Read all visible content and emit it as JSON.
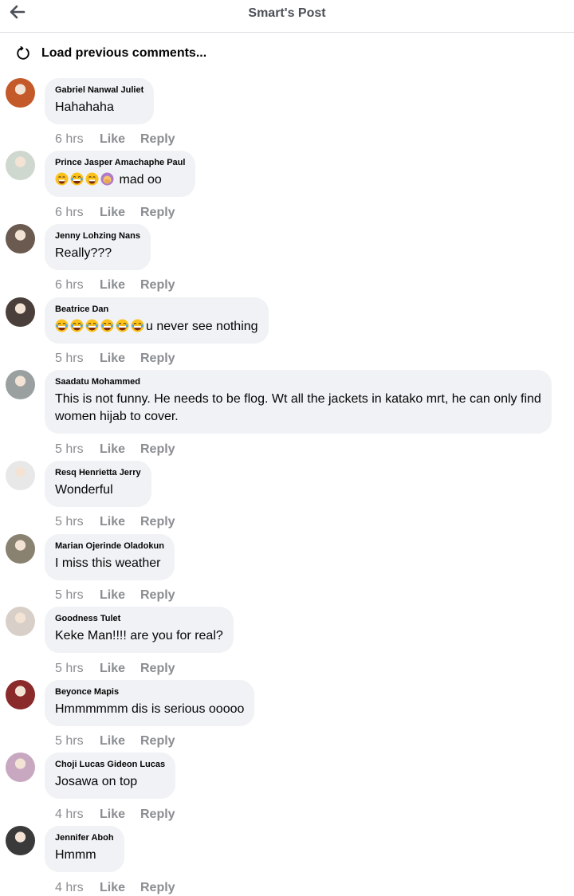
{
  "header": {
    "title": "Smart's Post",
    "back_icon": "arrow-left-icon"
  },
  "load_previous": {
    "label": "Load previous comments...",
    "icon": "refresh-icon"
  },
  "labels": {
    "like": "Like",
    "reply": "Reply"
  },
  "comments": [
    {
      "author": "Gabriel Nanwal Juliet",
      "text": "Hahahaha",
      "time": "6 hrs",
      "emojis": [],
      "avatar_color": "#c45a2a"
    },
    {
      "author": "Prince Jasper Amachaphe Paul",
      "text": "mad oo",
      "time": "6 hrs",
      "emojis": [
        "grin-emoji",
        "tears-of-joy-emoji",
        "grin-emoji",
        "facepalm-emoji"
      ],
      "avatar_color": "#cfd8cf"
    },
    {
      "author": "Jenny Lohzing Nans",
      "text": "Really???",
      "time": "6 hrs",
      "emojis": [],
      "avatar_color": "#6a5a50"
    },
    {
      "author": "Beatrice Dan",
      "text": "u never see nothing",
      "time": "5 hrs",
      "emojis": [
        "tears-of-joy-emoji",
        "tears-of-joy-emoji",
        "tears-of-joy-emoji",
        "tears-of-joy-emoji",
        "tears-of-joy-emoji",
        "tears-of-joy-emoji"
      ],
      "avatar_color": "#4a3f3a"
    },
    {
      "author": "Saadatu Mohammed",
      "text": "This is not funny. He needs to be flog. Wt all the jackets in katako mrt, he can only find women hijab to cover.",
      "time": "5 hrs",
      "emojis": [],
      "avatar_color": "#9aa0a0"
    },
    {
      "author": "Resq Henrietta Jerry",
      "text": "Wonderful",
      "time": "5 hrs",
      "emojis": [],
      "avatar_color": "#e8e8e8"
    },
    {
      "author": "Marian Ojerinde Oladokun",
      "text": "I miss this weather",
      "time": "5 hrs",
      "emojis": [],
      "avatar_color": "#8a8270"
    },
    {
      "author": "Goodness Tulet",
      "text": "Keke Man!!!! are you for real?",
      "time": "5 hrs",
      "emojis": [],
      "avatar_color": "#d8d0c8"
    },
    {
      "author": "Beyonce Mapis",
      "text": "Hmmmmmm dis is serious ooooo",
      "time": "5 hrs",
      "emojis": [],
      "avatar_color": "#8a2a2a"
    },
    {
      "author": "Choji Lucas Gideon Lucas",
      "text": "Josawa on top",
      "time": "4 hrs",
      "emojis": [],
      "avatar_color": "#c8a8c0"
    },
    {
      "author": "Jennifer Aboh",
      "text": "Hmmm",
      "time": "4 hrs",
      "emojis": [],
      "avatar_color": "#3a3a3a"
    }
  ]
}
